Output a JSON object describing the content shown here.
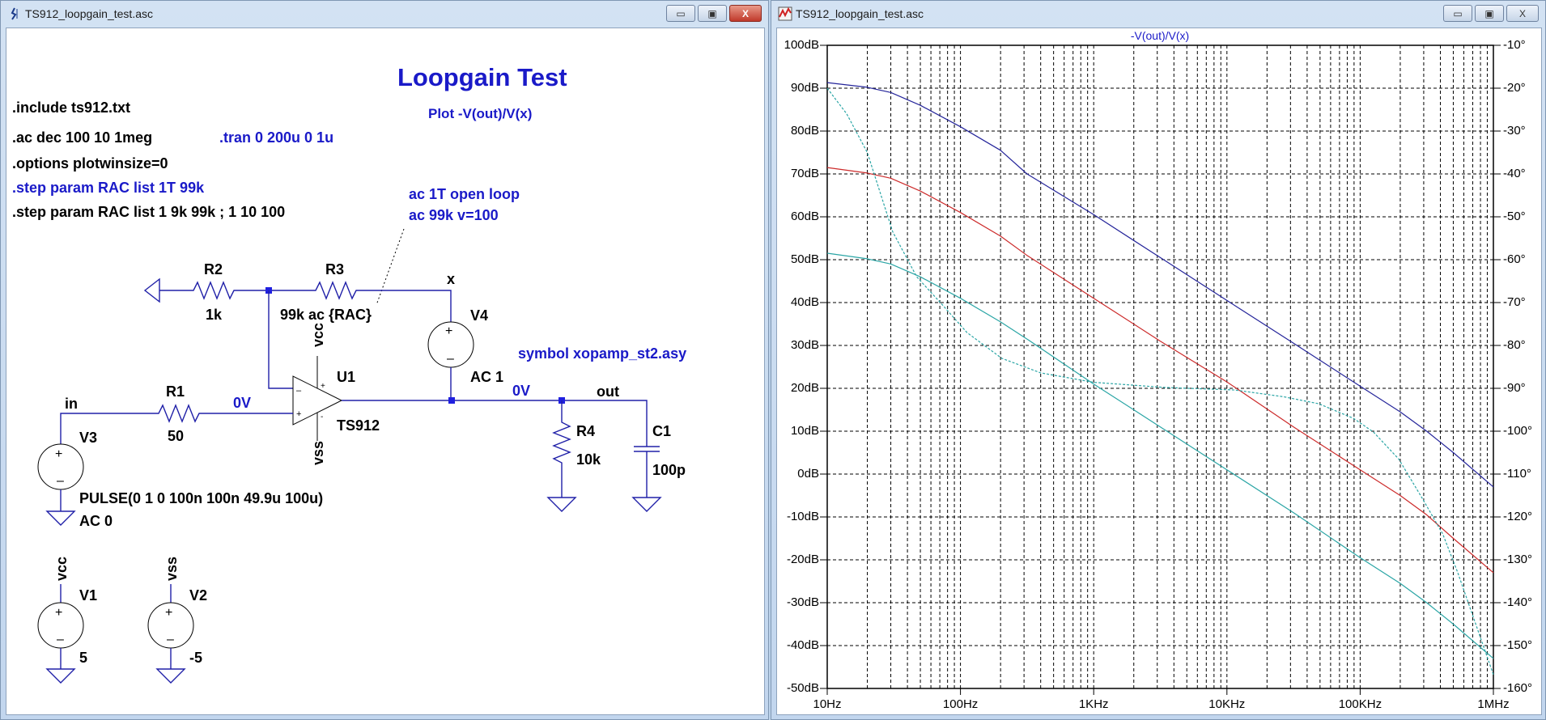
{
  "schematic_window": {
    "title": "TS912_loopgain_test.asc",
    "buttons": {
      "minimize": "▭",
      "maximize": "▣",
      "close": "X"
    },
    "heading": "Loopgain Test",
    "plot_note": "Plot -V(out)/V(x)",
    "directives": {
      "include": ".include ts912.txt",
      "ac": ".ac dec 100 10 1meg",
      "tran": ".tran 0 200u 0 1u",
      "options": ".options plotwinsize=0",
      "step_active": ".step param RAC list 1T 99k",
      "step_comment": ".step param RAC list 1 9k 99k ; 1 10 100"
    },
    "annotation": {
      "line1": "ac 1T open loop",
      "line2": "ac 99k v=100"
    },
    "symbol_note": "symbol xopamp_st2.asy",
    "components": {
      "R2": {
        "name": "R2",
        "value": "1k"
      },
      "R3": {
        "name": "R3",
        "value": "99k ac {RAC}"
      },
      "R1": {
        "name": "R1",
        "value": "50"
      },
      "R4": {
        "name": "R4",
        "value": "10k"
      },
      "C1": {
        "name": "C1",
        "value": "100p"
      },
      "V4": {
        "name": "V4",
        "value": "AC 1"
      },
      "V3": {
        "name": "V3",
        "value": "PULSE(0 1 0 100n 100n 49.9u 100u)",
        "ac": "AC 0"
      },
      "V1": {
        "name": "V1",
        "value": "5"
      },
      "V2": {
        "name": "V2",
        "value": "-5"
      },
      "U1": {
        "name": "U1",
        "value": "TS912"
      }
    },
    "nets": {
      "x": "x",
      "in": "in",
      "out": "out",
      "vcc": "vcc",
      "vss": "vss",
      "in_op": "0V",
      "out_op": "0V"
    }
  },
  "plot_window": {
    "title": "TS912_loopgain_test.asc",
    "buttons": {
      "minimize": "▭",
      "maximize": "▣",
      "close": "X"
    }
  },
  "colors": {
    "blue": "#24249a",
    "red": "#cc2a2a",
    "teal": "#2aa5a5",
    "grid": "#000000",
    "text_blue": "#1a1ac8"
  },
  "chart_data": {
    "type": "line",
    "title": "-V(out)/V(x)",
    "x_scale": "log",
    "xlim": [
      10,
      1000000
    ],
    "ylim": [
      -50,
      100
    ],
    "y2lim": [
      -160,
      -10
    ],
    "grid": true,
    "x_ticks": [
      {
        "value": 10,
        "label": "10Hz"
      },
      {
        "value": 100,
        "label": "100Hz"
      },
      {
        "value": 1000,
        "label": "1KHz"
      },
      {
        "value": 10000,
        "label": "10KHz"
      },
      {
        "value": 100000,
        "label": "100KHz"
      },
      {
        "value": 1000000,
        "label": "1MHz"
      }
    ],
    "y_ticks": [
      {
        "value": 100,
        "label": "100dB"
      },
      {
        "value": 90,
        "label": "90dB"
      },
      {
        "value": 80,
        "label": "80dB"
      },
      {
        "value": 70,
        "label": "70dB"
      },
      {
        "value": 60,
        "label": "60dB"
      },
      {
        "value": 50,
        "label": "50dB"
      },
      {
        "value": 40,
        "label": "40dB"
      },
      {
        "value": 30,
        "label": "30dB"
      },
      {
        "value": 20,
        "label": "20dB"
      },
      {
        "value": 10,
        "label": "10dB"
      },
      {
        "value": 0,
        "label": "0dB"
      },
      {
        "value": -10,
        "label": "-10dB"
      },
      {
        "value": -20,
        "label": "-20dB"
      },
      {
        "value": -30,
        "label": "-30dB"
      },
      {
        "value": -40,
        "label": "-40dB"
      },
      {
        "value": -50,
        "label": "-50dB"
      }
    ],
    "y2_ticks": [
      {
        "value": -10,
        "label": "-10°"
      },
      {
        "value": -20,
        "label": "-20°"
      },
      {
        "value": -30,
        "label": "-30°"
      },
      {
        "value": -40,
        "label": "-40°"
      },
      {
        "value": -50,
        "label": "-50°"
      },
      {
        "value": -60,
        "label": "-60°"
      },
      {
        "value": -70,
        "label": "-70°"
      },
      {
        "value": -80,
        "label": "-80°"
      },
      {
        "value": -90,
        "label": "-90°"
      },
      {
        "value": -100,
        "label": "-100°"
      },
      {
        "value": -110,
        "label": "-110°"
      },
      {
        "value": -120,
        "label": "-120°"
      },
      {
        "value": -130,
        "label": "-130°"
      },
      {
        "value": -140,
        "label": "-140°"
      },
      {
        "value": -150,
        "label": "-150°"
      },
      {
        "value": -160,
        "label": "-160°"
      }
    ],
    "series": [
      {
        "axis": "left",
        "style": "solid",
        "color": "#24249a",
        "x": [
          10,
          20,
          30,
          50,
          100,
          200,
          316,
          1000,
          3162,
          10000,
          31623,
          100000,
          200000,
          316000,
          500000,
          1000000
        ],
        "y": [
          91.3,
          90.2,
          89,
          86,
          81,
          75.5,
          70,
          60.5,
          50.5,
          40.5,
          30.5,
          20.5,
          14.5,
          10,
          5,
          -3
        ]
      },
      {
        "axis": "left",
        "style": "solid",
        "color": "#cc2a2a",
        "x": [
          10,
          20,
          30,
          50,
          100,
          200,
          316,
          1000,
          3162,
          10000,
          31623,
          100000,
          200000,
          316000,
          500000,
          1000000
        ],
        "y": [
          71.5,
          70.2,
          69,
          66,
          61,
          55.5,
          51,
          41,
          31,
          21.5,
          11,
          1,
          -5,
          -9.5,
          -15,
          -23
        ]
      },
      {
        "axis": "left",
        "style": "solid",
        "color": "#2aa5a5",
        "x": [
          10,
          20,
          30,
          50,
          100,
          200,
          316,
          1000,
          3162,
          10000,
          31623,
          100000,
          200000,
          316000,
          500000,
          1000000
        ],
        "y": [
          51.5,
          50.2,
          49,
          46,
          41,
          35.5,
          31.5,
          21,
          11,
          1,
          -9,
          -19.5,
          -25.5,
          -30,
          -35,
          -43
        ]
      },
      {
        "axis": "right",
        "style": "dashed",
        "color": "#2aa5a5",
        "x": [
          10,
          14,
          20,
          31,
          47,
          73,
          112,
          204,
          400,
          1000,
          3400,
          11500,
          27000,
          49000,
          89000,
          126000,
          195000,
          297000,
          417000,
          540000,
          700000,
          1000000
        ],
        "y": [
          -20,
          -26,
          -35,
          -53.5,
          -64,
          -70.5,
          -77,
          -83,
          -86.4,
          -88.6,
          -89.8,
          -90.4,
          -92,
          -93.6,
          -97,
          -100.2,
          -106.5,
          -116,
          -124,
          -133,
          -143,
          -156.8
        ]
      }
    ]
  }
}
